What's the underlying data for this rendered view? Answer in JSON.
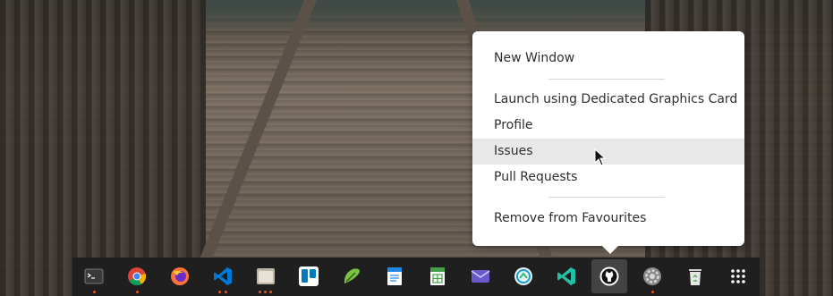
{
  "context_menu": {
    "items": [
      {
        "label": "New Window"
      },
      {
        "label": "Launch using Dedicated Graphics Card"
      },
      {
        "label": "Profile"
      },
      {
        "label": "Issues"
      },
      {
        "label": "Pull Requests"
      },
      {
        "label": "Remove from Favourites"
      }
    ],
    "hovered_index": 3
  },
  "dock": {
    "apps": [
      {
        "name": "terminal-icon",
        "running_dots": 1
      },
      {
        "name": "chrome-icon",
        "running_dots": 1
      },
      {
        "name": "firefox-icon",
        "running_dots": 0
      },
      {
        "name": "vscode-icon",
        "running_dots": 2
      },
      {
        "name": "files-icon",
        "running_dots": 3
      },
      {
        "name": "trello-icon",
        "running_dots": 0
      },
      {
        "name": "pencil-app-icon",
        "running_dots": 0
      },
      {
        "name": "document-icon",
        "running_dots": 0
      },
      {
        "name": "spreadsheet-icon",
        "running_dots": 0
      },
      {
        "name": "mail-icon",
        "running_dots": 0
      },
      {
        "name": "web-app-icon",
        "running_dots": 0
      },
      {
        "name": "vscode-insiders-icon",
        "running_dots": 0
      },
      {
        "name": "github-icon",
        "running_dots": 0,
        "active": true
      },
      {
        "name": "settings-icon",
        "running_dots": 1
      },
      {
        "name": "recycle-bin-icon",
        "running_dots": 0
      },
      {
        "name": "show-apps-icon",
        "running_dots": 0
      }
    ],
    "accent_color": "#e95420"
  }
}
